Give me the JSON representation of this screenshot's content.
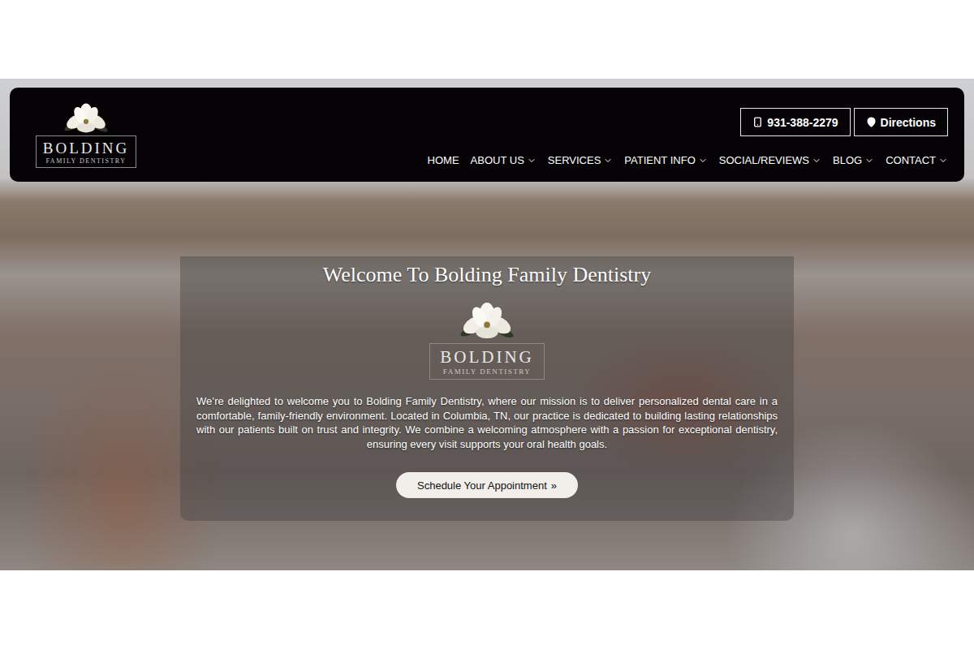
{
  "logo": {
    "name": "BOLDING",
    "tagline": "FAMILY DENTISTRY"
  },
  "header_buttons": [
    {
      "label": "931-388-2279",
      "kind": "phone"
    },
    {
      "label": "Directions",
      "kind": "directions"
    }
  ],
  "nav": [
    {
      "label": "HOME",
      "has_menu": false
    },
    {
      "label": "ABOUT US",
      "has_menu": true
    },
    {
      "label": "SERVICES",
      "has_menu": true
    },
    {
      "label": "PATIENT INFO",
      "has_menu": true
    },
    {
      "label": "SOCIAL/REVIEWS",
      "has_menu": true
    },
    {
      "label": "BLOG",
      "has_menu": true
    },
    {
      "label": "CONTACT",
      "has_menu": true
    }
  ],
  "hero": {
    "title": "Welcome To Bolding Family Dentistry",
    "body": "We’re delighted to welcome you to Bolding Family Dentistry, where our mission is to deliver personalized dental care in a comfortable, family-friendly environment. Located in Columbia, TN, our practice is dedicated to building lasting relationships with our patients built on trust and integrity. We combine a welcoming atmosphere with a passion for exceptional dentistry, ensuring every visit supports your oral health goals.",
    "button": {
      "label": "Schedule Your Appointment",
      "arrow": "»"
    }
  }
}
